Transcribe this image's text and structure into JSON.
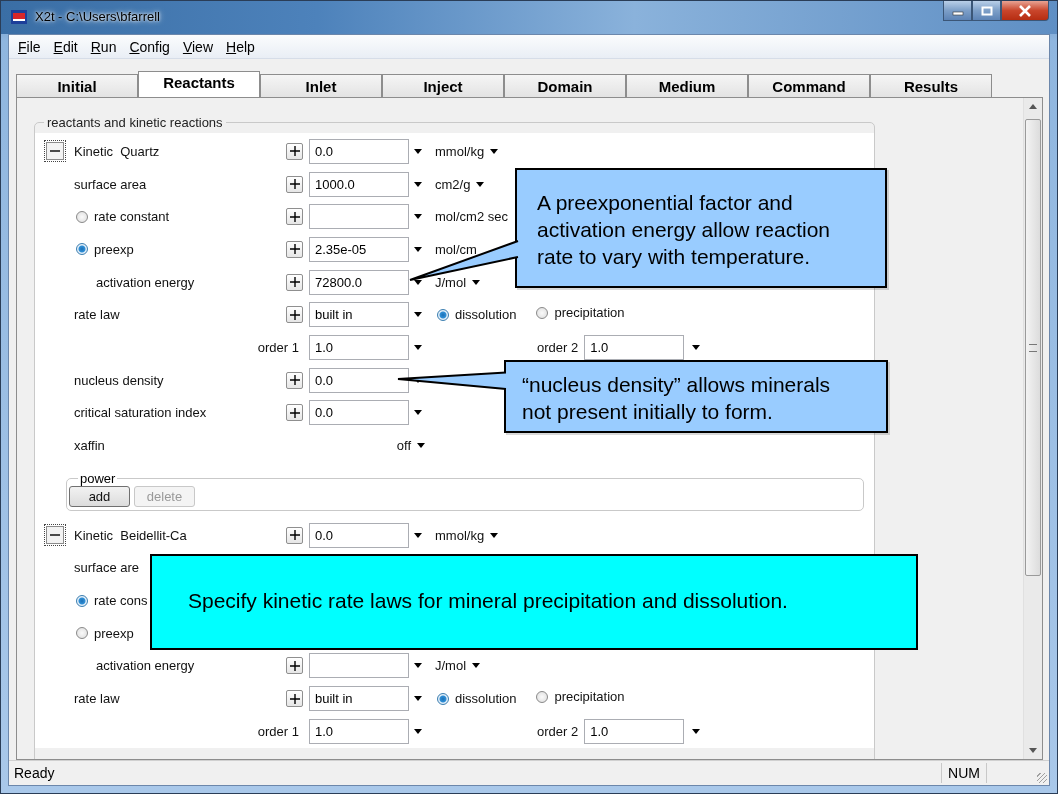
{
  "window": {
    "title": "X2t - C:\\Users\\bfarrell"
  },
  "menu": [
    "File",
    "Edit",
    "Run",
    "Config",
    "View",
    "Help"
  ],
  "tabs": [
    {
      "label": "Initial",
      "selected": false
    },
    {
      "label": "Reactants",
      "selected": true
    },
    {
      "label": "Inlet",
      "selected": false
    },
    {
      "label": "Inject",
      "selected": false
    },
    {
      "label": "Domain",
      "selected": false
    },
    {
      "label": "Medium",
      "selected": false
    },
    {
      "label": "Command",
      "selected": false
    },
    {
      "label": "Results",
      "selected": false
    }
  ],
  "group": {
    "title": "reactants and kinetic reactions",
    "rows": [
      {
        "kind": "header",
        "expanded": true,
        "label": "Kinetic  Quartz",
        "value": "0.0",
        "unit": "mmol/kg",
        "unit_menu": true
      },
      {
        "kind": "field",
        "label": "surface area",
        "value": "1000.0",
        "unit": "cm2/g",
        "unit_menu": true
      },
      {
        "kind": "radio",
        "label": "rate constant",
        "selected": false,
        "unit": "mol/cm2 sec",
        "unit_menu": false
      },
      {
        "kind": "radio",
        "label": "preexp",
        "selected": true,
        "value": "2.35e-05",
        "unit": "mol/cm",
        "unit_menu": false
      },
      {
        "kind": "subfield",
        "label": "activation energy",
        "value": "72800.0",
        "unit": "J/mol",
        "unit_menu": true
      },
      {
        "kind": "ratelaw",
        "label": "rate law",
        "value": "built in",
        "options": [
          {
            "label": "dissolution",
            "selected": true
          },
          {
            "label": "precipitation",
            "selected": false
          }
        ]
      },
      {
        "kind": "order",
        "fields": [
          {
            "label": "order 1",
            "value": "1.0"
          },
          {
            "label": "order 2",
            "value": "1.0"
          }
        ]
      },
      {
        "kind": "field",
        "label": "nucleus density",
        "value": "0.0"
      },
      {
        "kind": "field",
        "label": "critical saturation index",
        "value": "0.0"
      },
      {
        "kind": "switch",
        "label": "xaffin",
        "value": "off"
      },
      {
        "kind": "power",
        "title": "power",
        "buttons": [
          {
            "label": "add",
            "disabled": false
          },
          {
            "label": "delete",
            "disabled": true
          }
        ]
      },
      {
        "kind": "header",
        "expanded": true,
        "label": "Kinetic  Beidellit-Ca",
        "value": "0.0",
        "unit": "mmol/kg",
        "unit_menu": true
      },
      {
        "kind": "covered",
        "label": "surface are"
      },
      {
        "kind": "covered-radio",
        "label": "rate cons",
        "selected": true
      },
      {
        "kind": "covered-radio",
        "label": "preexp",
        "selected": false
      },
      {
        "kind": "subfield",
        "label": "activation energy",
        "unit": "J/mol",
        "unit_menu": true
      },
      {
        "kind": "ratelaw",
        "label": "rate law",
        "value": "built in",
        "options": [
          {
            "label": "dissolution",
            "selected": true
          },
          {
            "label": "precipitation",
            "selected": false
          }
        ]
      },
      {
        "kind": "order",
        "fields": [
          {
            "label": "order 1",
            "value": "1.0"
          },
          {
            "label": "order 2",
            "value": "1.0"
          }
        ]
      }
    ]
  },
  "callouts": [
    {
      "kind": "pointer",
      "text": "A preexponential factor and activation energy allow reaction rate to vary with temperature."
    },
    {
      "kind": "pointer",
      "text": "“nucleus density” allows minerals not present initially to form."
    },
    {
      "kind": "banner",
      "text": "Specify kinetic rate laws for mineral precipitation and dissolution."
    }
  ],
  "status_bar": {
    "message": "Ready",
    "indicators": [
      "NUM"
    ]
  }
}
